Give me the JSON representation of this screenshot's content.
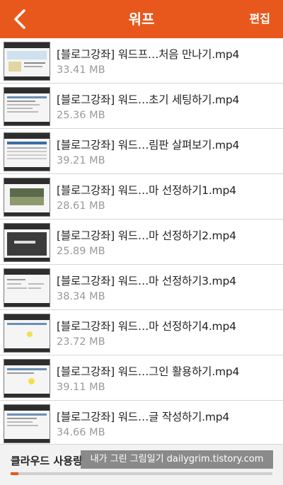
{
  "header": {
    "title": "워프",
    "edit_label": "편집"
  },
  "files": [
    {
      "name": "[블로그강좌] 워드프…처음 만나기.mp4",
      "size": "33.41 MB",
      "thumb": "intro"
    },
    {
      "name": "[블로그강좌] 워드…초기 세팅하기.mp4",
      "size": "25.36 MB",
      "thumb": "setup"
    },
    {
      "name": "[블로그강좌] 워드…림판 살펴보기.mp4",
      "size": "39.21 MB",
      "thumb": "table"
    },
    {
      "name": "[블로그강좌] 워드…마 선정하기1.mp4",
      "size": "28.61 MB",
      "thumb": "photo"
    },
    {
      "name": "[블로그강좌] 워드…마 선정하기2.mp4",
      "size": "25.89 MB",
      "thumb": "dark"
    },
    {
      "name": "[블로그강좌] 워드…마 선정하기3.mp4",
      "size": "38.34 MB",
      "thumb": "list"
    },
    {
      "name": "[블로그강좌] 워드…마 선정하기4.mp4",
      "size": "23.72 MB",
      "thumb": "blank"
    },
    {
      "name": "[블로그강좌] 워드…그인 활용하기.mp4",
      "size": "39.11 MB",
      "thumb": "plugin"
    },
    {
      "name": "[블로그강좌] 워드…글 작성하기.mp4",
      "size": "34.66 MB",
      "thumb": "editor"
    }
  ],
  "footer": {
    "cloud_label": "클라우드 사용량",
    "usage_fraction": 0.03
  },
  "watermark": "내가 그린 그림일기 dailygrim.tistory.com",
  "colors": {
    "accent": "#e8581c",
    "highlight": "#f4e04d"
  }
}
